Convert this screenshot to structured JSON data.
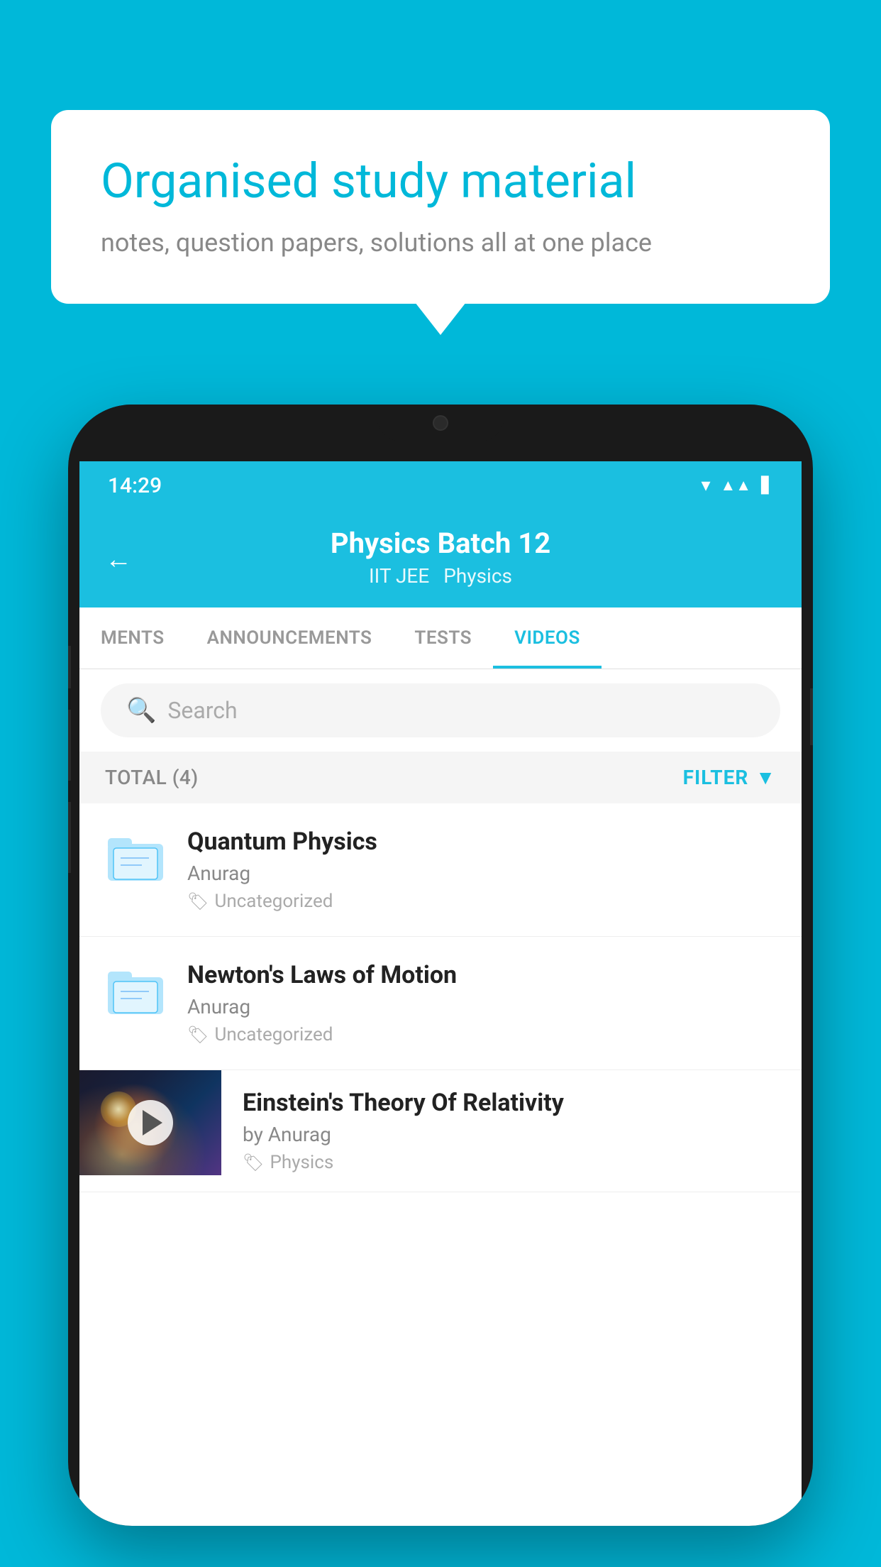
{
  "background_color": "#00B8D9",
  "speech_bubble": {
    "title": "Organised study material",
    "subtitle": "notes, question papers, solutions all at one place"
  },
  "phone": {
    "status_bar": {
      "time": "14:29",
      "icons": [
        "wifi",
        "signal",
        "battery"
      ]
    },
    "header": {
      "back_label": "←",
      "title": "Physics Batch 12",
      "subtitle_part1": "IIT JEE",
      "subtitle_part2": "Physics"
    },
    "tabs": [
      {
        "label": "MENTS",
        "active": false
      },
      {
        "label": "ANNOUNCEMENTS",
        "active": false
      },
      {
        "label": "TESTS",
        "active": false
      },
      {
        "label": "VIDEOS",
        "active": true
      }
    ],
    "search": {
      "placeholder": "Search"
    },
    "filter_bar": {
      "total_label": "TOTAL (4)",
      "filter_label": "FILTER"
    },
    "videos": [
      {
        "id": 1,
        "title": "Quantum Physics",
        "author": "Anurag",
        "tag": "Uncategorized",
        "type": "folder"
      },
      {
        "id": 2,
        "title": "Newton's Laws of Motion",
        "author": "Anurag",
        "tag": "Uncategorized",
        "type": "folder"
      },
      {
        "id": 3,
        "title": "Einstein's Theory Of Relativity",
        "author": "by Anurag",
        "tag": "Physics",
        "type": "video"
      }
    ]
  }
}
